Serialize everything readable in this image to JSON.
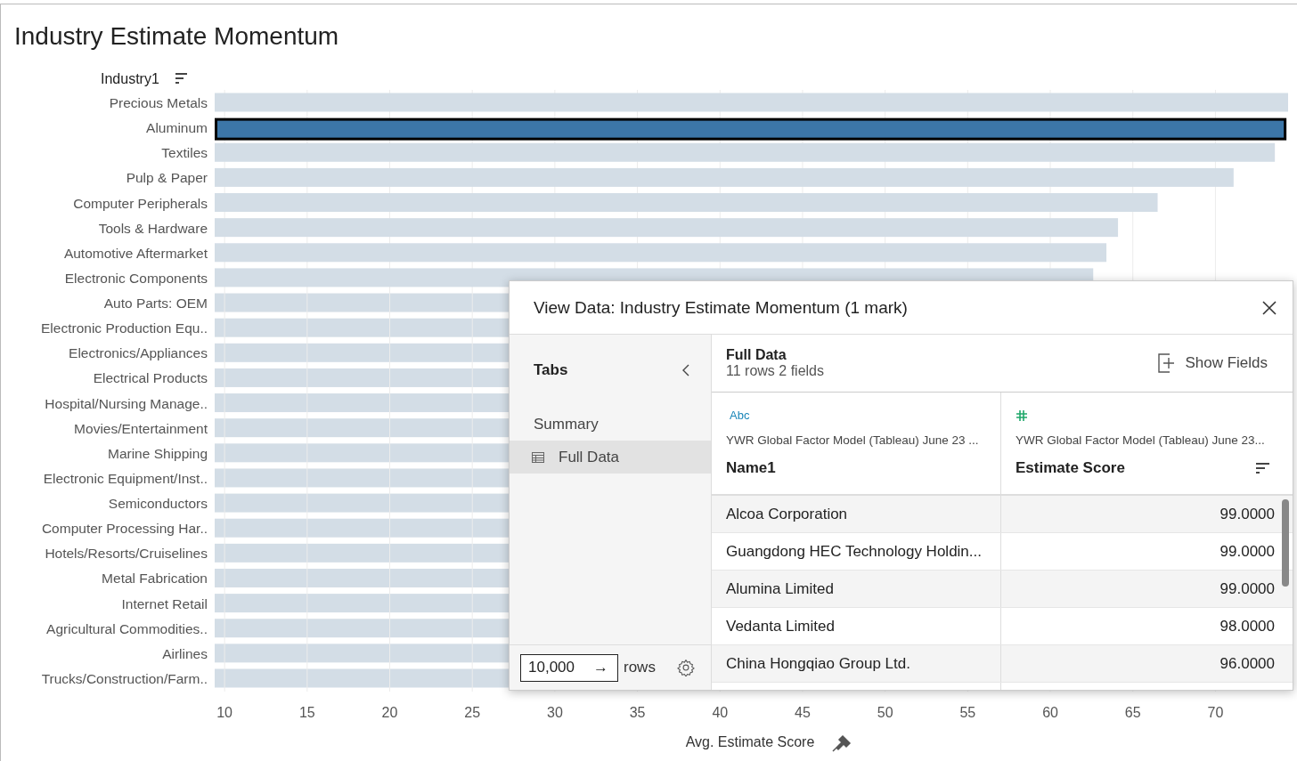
{
  "title": "Industry Estimate Momentum",
  "chart": {
    "row_header": "Industry1",
    "chart_data": {
      "type": "bar",
      "orientation": "horizontal",
      "xlabel": "Avg. Estimate Score",
      "categories": [
        "Precious Metals",
        "Aluminum",
        "Textiles",
        "Pulp & Paper",
        "Computer Peripherals",
        "Tools & Hardware",
        "Automotive Aftermarket",
        "Electronic Components",
        "Auto Parts: OEM",
        "Electronic Production Equ..",
        "Electronics/Appliances",
        "Electrical Products",
        "Hospital/Nursing Manage..",
        "Movies/Entertainment",
        "Marine Shipping",
        "Electronic Equipment/Inst..",
        "Semiconductors",
        "Computer Processing Har..",
        "Hotels/Resorts/Cruiselines",
        "Metal Fabrication",
        "Internet Retail",
        "Agricultural Commodities..",
        "Airlines",
        "Trucks/Construction/Farm.."
      ],
      "values": [
        74.4,
        74.3,
        73.6,
        71.1,
        66.5,
        64.1,
        63.4,
        62.6,
        null,
        null,
        null,
        null,
        null,
        null,
        null,
        null,
        null,
        null,
        null,
        null,
        null,
        null,
        null,
        null
      ],
      "xlim": [
        9.4,
        74.4
      ],
      "grid": true,
      "xticks": [
        10,
        15,
        20,
        25,
        30,
        35,
        40,
        45,
        50,
        55,
        60,
        65,
        70
      ]
    },
    "bar_states": [
      {
        "selected": false
      },
      {
        "selected": true
      },
      {
        "selected": false
      },
      {
        "selected": false
      },
      {
        "selected": false
      },
      {
        "selected": false
      },
      {
        "selected": false
      },
      {
        "selected": false
      },
      {
        "selected": false
      },
      {
        "selected": false
      },
      {
        "selected": false
      },
      {
        "selected": false
      },
      {
        "selected": false
      },
      {
        "selected": false
      },
      {
        "selected": false
      },
      {
        "selected": false
      },
      {
        "selected": false
      },
      {
        "selected": false
      },
      {
        "selected": false
      },
      {
        "selected": false
      },
      {
        "selected": false
      },
      {
        "selected": false
      },
      {
        "selected": false
      },
      {
        "selected": false
      }
    ]
  },
  "dialog": {
    "title": "View Data: Industry Estimate Momentum (1 mark)",
    "tabs_heading": "Tabs",
    "tabs": [
      {
        "label": "Summary",
        "selected": false
      },
      {
        "label": "Full Data",
        "selected": true
      }
    ],
    "rows_input": {
      "value": "10,000",
      "arrow": "→",
      "unit": "rows"
    },
    "panel": {
      "title": "Full Data",
      "subtitle": "11 rows 2 fields",
      "show_fields": "Show Fields"
    },
    "columns": [
      {
        "kind": "text",
        "type_label": "Abc",
        "source": "YWR Global Factor Model (Tableau) June 23 ...",
        "name": "Name1"
      },
      {
        "kind": "number",
        "source": "YWR Global Factor Model (Tableau) June 23...",
        "name": "Estimate Score"
      }
    ],
    "rows": [
      [
        "Alcoa Corporation",
        "99.0000"
      ],
      [
        "Guangdong HEC Technology Holdin...",
        "99.0000"
      ],
      [
        "Alumina Limited",
        "99.0000"
      ],
      [
        "Vedanta Limited",
        "98.0000"
      ],
      [
        "China Hongqiao Group Ltd.",
        "96.0000"
      ]
    ]
  }
}
